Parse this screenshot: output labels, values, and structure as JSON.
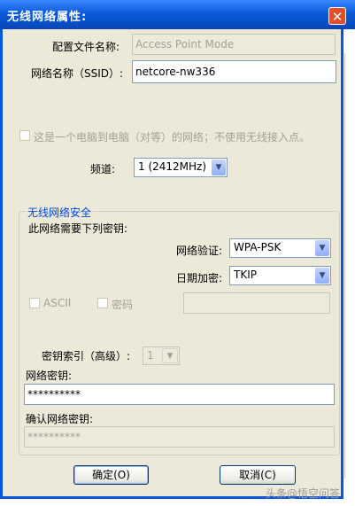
{
  "window": {
    "title": "无线网络属性:",
    "close_glyph": "✕"
  },
  "profile": {
    "label": "配置文件名称:",
    "value": "Access Point Mode"
  },
  "ssid": {
    "label": "网络名称（SSID）:",
    "value": "netcore-nw336"
  },
  "adhoc": {
    "label": "这是一个电脑到电脑（对等）的网络；不使用无线接入点。",
    "checked": false
  },
  "channel": {
    "label": "频道:",
    "value": "1 (2412MHz)"
  },
  "security": {
    "legend": "无线网络安全",
    "need_key_label": "此网络需要下列密钥:",
    "auth_label": "网络验证:",
    "auth_value": "WPA-PSK",
    "encrypt_label": "日期加密:",
    "encrypt_value": "TKIP",
    "ascii_label": "ASCII",
    "password_label": "密码",
    "key_index_label": "密钥索引（高级）:",
    "key_index_value": "1",
    "net_key_label": "网络密钥:",
    "net_key_value": "**********",
    "confirm_key_label": "确认网络密钥:",
    "confirm_key_value": "**********"
  },
  "buttons": {
    "ok": "确定(O)",
    "cancel": "取消(C)"
  },
  "watermark": "头条@悟空问答"
}
